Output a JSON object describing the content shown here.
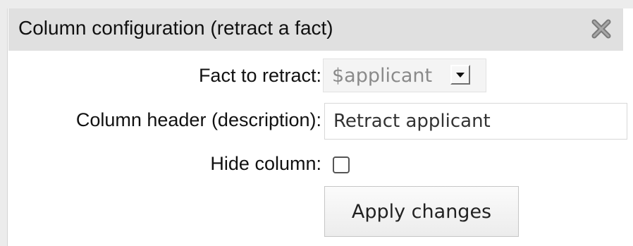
{
  "dialog": {
    "title": "Column configuration (retract a fact)",
    "close_icon": "close-x-icon"
  },
  "form": {
    "fact_label": "Fact to retract:",
    "fact_value": "$applicant",
    "header_label": "Column header (description):",
    "header_value": "Retract applicant",
    "hide_label": "Hide column:",
    "hide_checked": false,
    "apply_label": "Apply changes"
  }
}
